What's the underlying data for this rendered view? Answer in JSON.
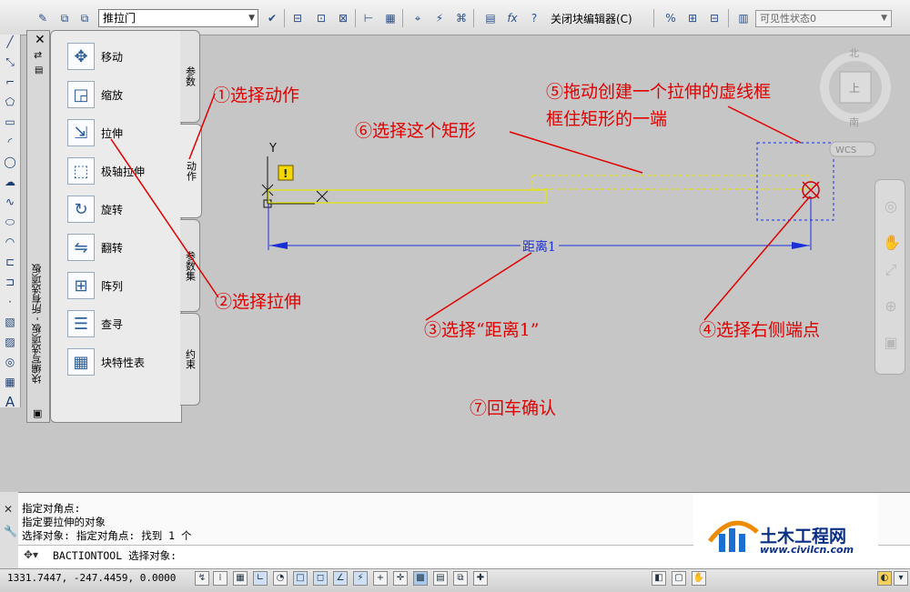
{
  "toolbar": {
    "block_name": "推拉门",
    "close_editor": "关闭块编辑器(C)",
    "visibility_state": "可见性状态0"
  },
  "palette": {
    "items": [
      {
        "label": "移动",
        "icon": "move-icon"
      },
      {
        "label": "缩放",
        "icon": "scale-icon"
      },
      {
        "label": "拉伸",
        "icon": "stretch-icon"
      },
      {
        "label": "极轴拉伸",
        "icon": "polar-stretch-icon"
      },
      {
        "label": "旋转",
        "icon": "rotate-icon"
      },
      {
        "label": "翻转",
        "icon": "flip-icon"
      },
      {
        "label": "阵列",
        "icon": "array-icon"
      },
      {
        "label": "查寻",
        "icon": "lookup-icon"
      },
      {
        "label": "块特性表",
        "icon": "block-table-icon"
      }
    ],
    "tabs": [
      "参数",
      "动作",
      "参数集",
      "约束"
    ],
    "vertical_title": "块编写选项板 - 所有选项板"
  },
  "canvas": {
    "y_axis_label": "Y",
    "dimension_label": "距离1",
    "compass_north": "北",
    "compass_south": "南",
    "wcs_label": "WCS"
  },
  "annotations": {
    "a1": "①选择动作",
    "a2": "②选择拉伸",
    "a3": "③选择“距离1”",
    "a4": "④选择右侧端点",
    "a5_line1": "⑤拖动创建一个拉伸的虚线框",
    "a5_line2": "框住矩形的一端",
    "a6": "⑥选择这个矩形",
    "a7": "⑦回车确认"
  },
  "command": {
    "history": [
      "指定对角点:",
      "指定要拉伸的对象",
      "选择对象: 指定对角点: 找到 1 个"
    ],
    "prompt": "BACTIONTOOL 选择对象:"
  },
  "status": {
    "coordinates": "1331.7447, -247.4459, 0.0000"
  },
  "logo": {
    "title": "土木工程网",
    "url": "www.civilcn.com"
  },
  "colors": {
    "annotation": "#e00000",
    "dimension": "#1a2fd6",
    "rectangle": "#e6e600"
  }
}
